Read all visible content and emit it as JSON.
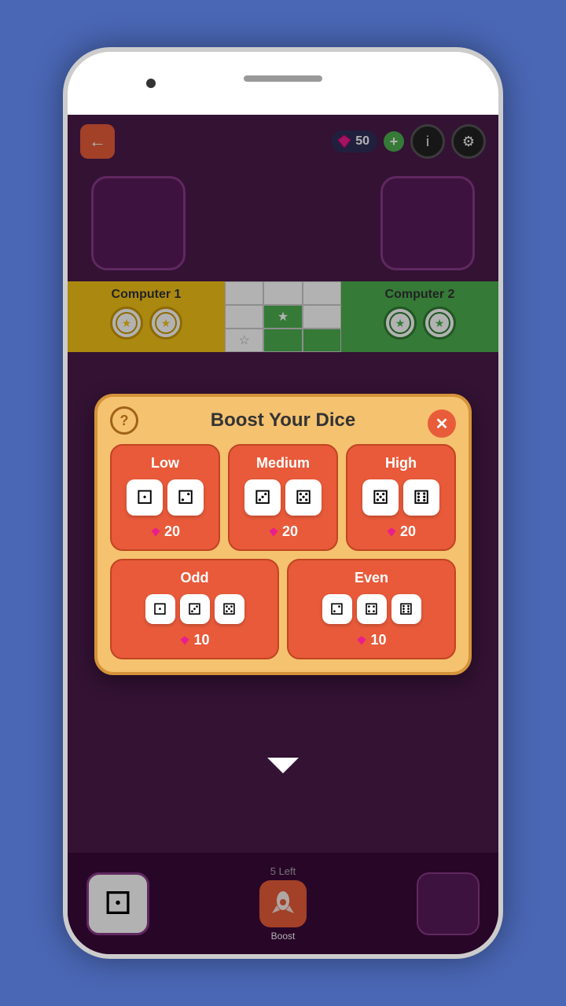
{
  "header": {
    "back_label": "←",
    "gem_count": "50",
    "add_label": "+",
    "info_label": "i",
    "settings_label": "⚙"
  },
  "players": {
    "computer1": "Computer 1",
    "computer2": "Computer 2"
  },
  "modal": {
    "title": "Boost Your Dice",
    "help_label": "?",
    "close_label": "✕",
    "options": [
      {
        "id": "low",
        "label": "Low",
        "dice": [
          "⚀",
          "⚁"
        ],
        "cost": "20"
      },
      {
        "id": "medium",
        "label": "Medium",
        "dice": [
          "⚂",
          "⚄"
        ],
        "cost": "20"
      },
      {
        "id": "high",
        "label": "High",
        "dice": [
          "⚄",
          "⚅"
        ],
        "cost": "20"
      },
      {
        "id": "odd",
        "label": "Odd",
        "dice": [
          "⚀",
          "⚂",
          "⚄"
        ],
        "cost": "10"
      },
      {
        "id": "even",
        "label": "Even",
        "dice": [
          "⚁",
          "⚃",
          "⚅"
        ],
        "cost": "10"
      }
    ]
  },
  "bottom": {
    "left_count": "5 Left",
    "boost_label": "Boost",
    "dice_face": "⚀"
  }
}
